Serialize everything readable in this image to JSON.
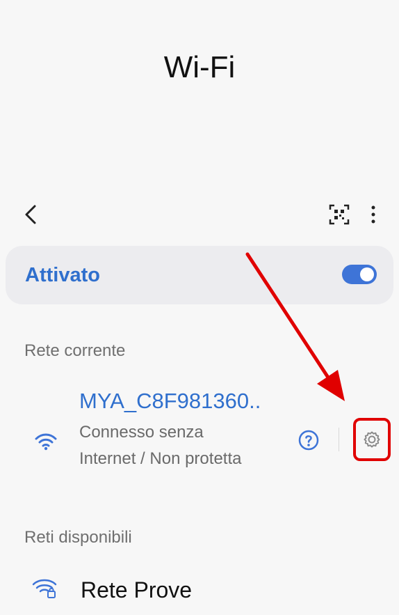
{
  "page": {
    "title": "Wi-Fi"
  },
  "toolbar": {
    "back_icon": "chevron-left",
    "qr_icon": "qr-scan",
    "more_icon": "vertical-dots"
  },
  "wifi_toggle": {
    "label": "Attivato",
    "enabled": true,
    "accent": "#2f6fcd"
  },
  "sections": {
    "current": "Rete corrente",
    "available": "Reti disponibili"
  },
  "current_network": {
    "name": "MYA_C8F981360..",
    "status": "Connesso senza Internet / Non protetta",
    "signal_icon": "wifi-signal",
    "help_icon": "question-circle",
    "settings_icon": "gear"
  },
  "available_networks": [
    {
      "name": "Rete Prove",
      "signal_icon": "wifi-locked"
    }
  ],
  "annotation": {
    "highlight_color": "#e00000"
  }
}
